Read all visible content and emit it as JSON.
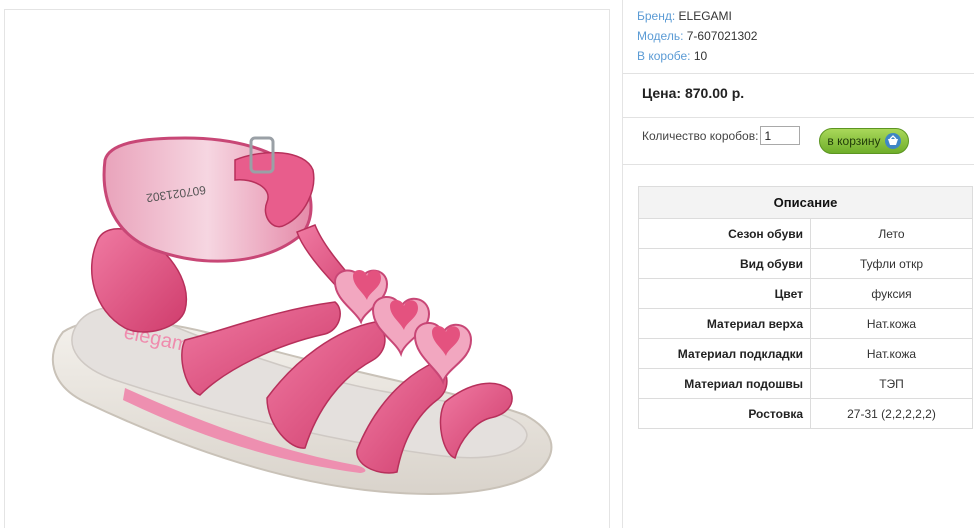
{
  "product_image": {
    "sole_imprint_text": "elegami",
    "strap_code_text": "607021302"
  },
  "attributes": [
    {
      "key": "Бренд:",
      "value": "ELEGAMI"
    },
    {
      "key": "Модель:",
      "value": "7-607021302"
    },
    {
      "key": "В коробе:",
      "value": "10"
    }
  ],
  "price": {
    "text": "Цена: 870.00 р."
  },
  "order": {
    "quantity_label": "Количество коробов:",
    "quantity_value": "1",
    "cart_button_label": "в корзину",
    "cart_icon": "cart-plus-icon"
  },
  "description": {
    "title": "Описание",
    "rows": [
      {
        "key": "Сезон обуви",
        "value": "Лето"
      },
      {
        "key": "Вид обуви",
        "value": "Туфли откр"
      },
      {
        "key": "Цвет",
        "value": "фуксия"
      },
      {
        "key": "Материал верха",
        "value": "Нат.кожа"
      },
      {
        "key": "Материал подкладки",
        "value": "Нат.кожа"
      },
      {
        "key": "Материал подошвы",
        "value": "ТЭП"
      },
      {
        "key": "Ростовка",
        "value": "27-31 (2,2,2,2,2)"
      }
    ]
  },
  "colors": {
    "link_blue": "#5b9bd5",
    "button_green": "#7dbb35",
    "sandal_pink": "#e4527f"
  }
}
